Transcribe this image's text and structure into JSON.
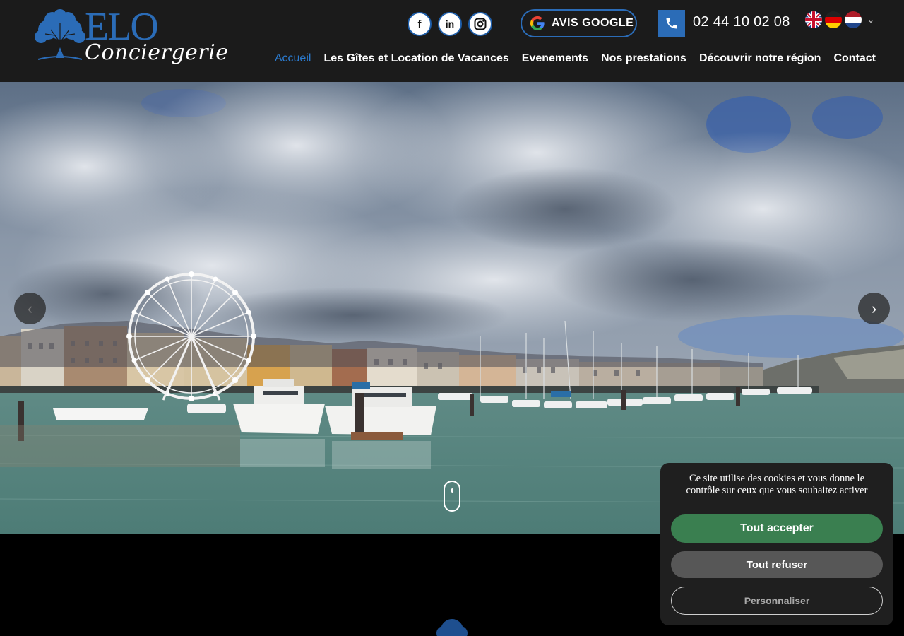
{
  "brand": {
    "name": "ELO",
    "tagline": "Conciergerie",
    "color": "#2b6cb7"
  },
  "socials": [
    {
      "name": "facebook",
      "glyph": "f"
    },
    {
      "name": "linkedin",
      "glyph": "in"
    },
    {
      "name": "instagram",
      "glyph": ""
    }
  ],
  "google": {
    "label": "AVIS GOOGLE"
  },
  "phone": {
    "number": "02 44 10 02 08"
  },
  "languages": [
    "en",
    "de",
    "nl"
  ],
  "nav": {
    "items": [
      {
        "label": "Accueil",
        "active": true
      },
      {
        "label": "Les Gîtes et Location de Vacances"
      },
      {
        "label": "Evenements"
      },
      {
        "label": "Nos prestations"
      },
      {
        "label": "Découvrir notre région"
      },
      {
        "label": "Contact"
      }
    ],
    "active_color": "#2b7bd0"
  },
  "hero": {
    "slides_nav": {
      "prev": "‹",
      "next": "›"
    }
  },
  "cookie": {
    "message": "Ce site utilise des cookies et vous donne le contrôle sur ceux que vous souhaitez activer",
    "accept": "Tout accepter",
    "refuse": "Tout refuser",
    "customize": "Personnaliser",
    "accept_color": "#3a7f50"
  }
}
